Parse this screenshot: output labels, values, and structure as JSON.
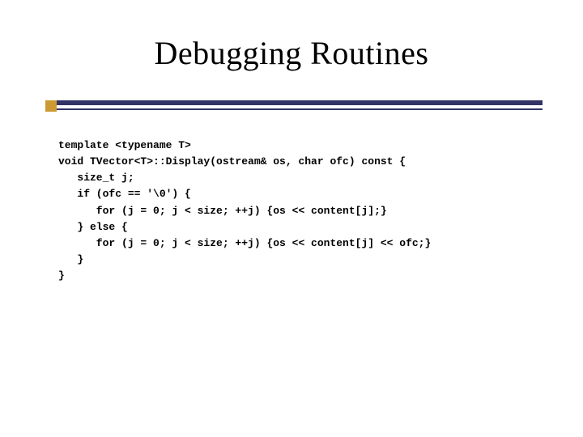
{
  "title": "Debugging Routines",
  "code": {
    "l1": "template <typename T>",
    "l2": "void TVector<T>::Display(ostream& os, char ofc) const {",
    "l3": "   size_t j;",
    "l4": "   if (ofc == '\\0') {",
    "l5": "      for (j = 0; j < size; ++j) {os << content[j];}",
    "l6": "   } else {",
    "l7": "      for (j = 0; j < size; ++j) {os << content[j] << ofc;}",
    "l8": "   }",
    "l9": "}"
  }
}
